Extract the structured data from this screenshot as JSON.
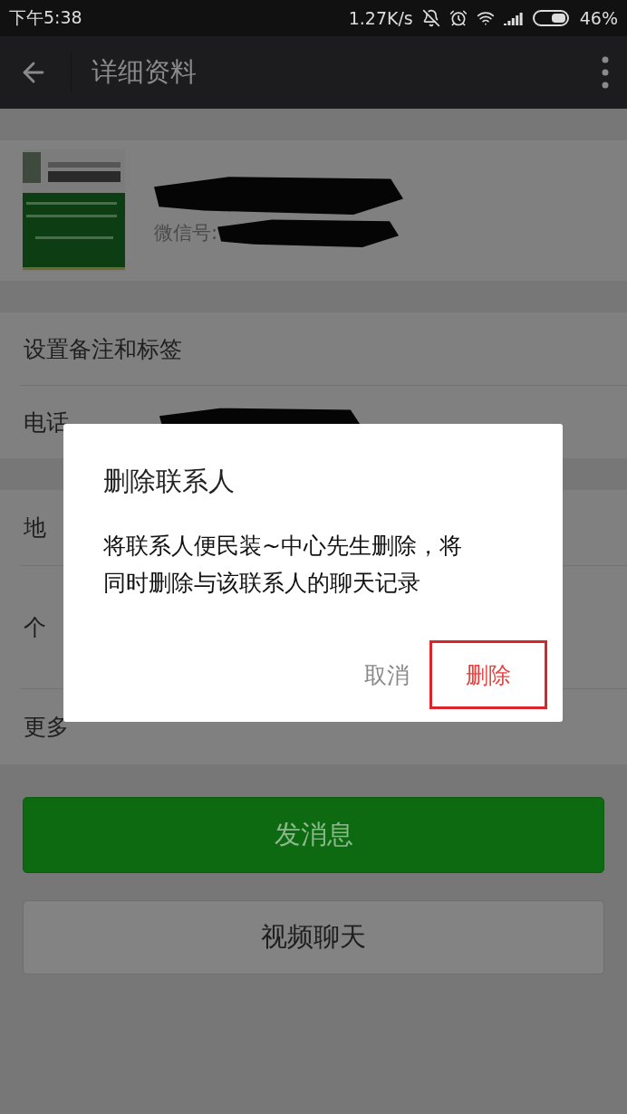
{
  "status_bar": {
    "time": "下午5:38",
    "speed": "1.27K/s",
    "battery": "46%"
  },
  "app_bar": {
    "title": "详细资料"
  },
  "profile": {
    "wechat_id_label": "微信号:"
  },
  "sections": [
    {
      "rows": [
        {
          "label": "设置备注和标签",
          "redacted": false
        },
        {
          "label": "电话",
          "redacted": true
        }
      ]
    },
    {
      "rows": [
        {
          "label": "地",
          "tall": false
        },
        {
          "label": "个",
          "tall": true
        },
        {
          "label": "更多",
          "tall": false
        }
      ]
    }
  ],
  "buttons": [
    {
      "label": "发消息",
      "kind": "primary"
    },
    {
      "label": "视频聊天",
      "kind": "secondary"
    }
  ],
  "dialog": {
    "title": "删除联系人",
    "message": "将联系人便民装~中心先生删除，将同时删除与该联系人的聊天记录",
    "actions": [
      {
        "label": "取消",
        "kind": "cancel",
        "highlighted": false
      },
      {
        "label": "删除",
        "kind": "danger",
        "highlighted": true
      }
    ]
  }
}
